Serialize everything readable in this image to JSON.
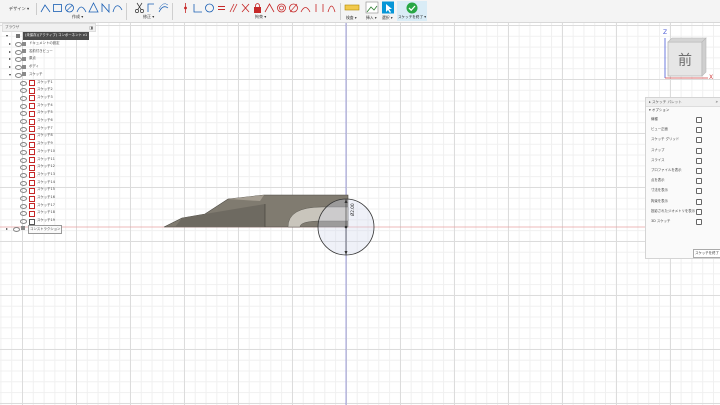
{
  "toolbar": {
    "mode_label": "デザイン ▾",
    "groups": {
      "create": "作成 ▾",
      "modify": "修正 ▾",
      "constraints": "拘束 ▾",
      "inspect": "検査 ▾",
      "insert": "挿入 ▾",
      "select": "選択 ▾",
      "finish": "スケッチを終了 ▾"
    }
  },
  "browser": {
    "header": "ブラウザ",
    "document": "(未保存)(アクティブ) コンポーネント v1",
    "top_rows": [
      "ドキュメントの設定",
      "名前付きビュー",
      "原点",
      "ボディ",
      "スケッチ"
    ],
    "sketches": [
      "スケッチ1",
      "スケッチ2",
      "スケッチ3",
      "スケッチ4",
      "スケッチ5",
      "スケッチ6",
      "スケッチ7",
      "スケッチ8",
      "スケッチ9",
      "スケッチ10",
      "スケッチ11",
      "スケッチ12",
      "スケッチ13",
      "スケッチ14",
      "スケッチ15",
      "スケッチ16",
      "スケッチ17",
      "スケッチ18",
      "スケッチ19"
    ],
    "components": "コンストラクション"
  },
  "viewcube": {
    "face": "前",
    "axis_z": "Z",
    "axis_x": "X"
  },
  "dimension": {
    "value": "Ø2.00"
  },
  "palette": {
    "title": "▸ スケッチ パレット",
    "section": "▾ オプション",
    "rows": [
      "線種",
      "ビュー正面",
      "スケッチ グリッド",
      "スナップ",
      "スライス",
      "プロファイルを表示",
      "点を表示",
      "寸法を表示",
      "拘束を表示",
      "投影されたジオメトリを表示",
      "3D スケッチ"
    ],
    "finish_button": "スケッチを終了"
  },
  "colors": {
    "x_axis": "#e8a0a0",
    "z_axis": "#8a8ad6",
    "accent": "#0696d7",
    "finish": "#28a745"
  }
}
